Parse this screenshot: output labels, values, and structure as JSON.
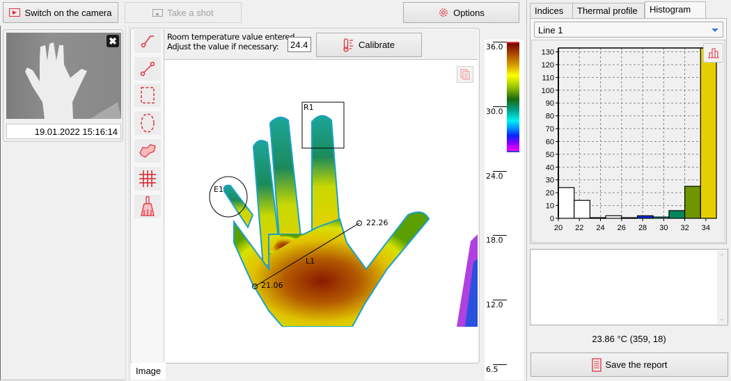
{
  "toolbar": {
    "camera_button": "Switch on the camera",
    "shot_button": "Take a shot",
    "options_button": "Options",
    "accent_color": "#e0303a"
  },
  "thumbnail": {
    "timestamp": "19.01.2022 15:16:14"
  },
  "calibration": {
    "message_line1": "Room temperature value entered.",
    "message_line2": "Adjust the value if necessary:",
    "room_temperature": "24.4",
    "calibrate_button": "Calibrate"
  },
  "tools": [
    {
      "name": "spot-line-tool-icon"
    },
    {
      "name": "line-tool-icon"
    },
    {
      "name": "rectangle-tool-icon"
    },
    {
      "name": "ellipse-tool-icon"
    },
    {
      "name": "polygon-tool-icon"
    },
    {
      "name": "grid-tool-icon"
    },
    {
      "name": "clear-tool-icon"
    }
  ],
  "image": {
    "tab_label": "Image",
    "annotations": {
      "rect_label": "R1",
      "ellipse_label": "E1",
      "line_label": "L1",
      "line_end_value": "22.26",
      "line_start_value": "21.06"
    }
  },
  "color_scale": {
    "labels": [
      "36.0",
      "30.0",
      "24.0",
      "18.0",
      "12.0",
      "6.5"
    ]
  },
  "right_panel": {
    "tabs": [
      {
        "label": "Indices",
        "active": false
      },
      {
        "label": "Thermal profile",
        "active": false
      },
      {
        "label": "Histogram",
        "active": true
      }
    ],
    "selector_value": "Line 1",
    "notes_text": "",
    "cursor_readout": "23.86 °C (359, 18)",
    "save_button": "Save the report"
  },
  "chart_data": {
    "type": "bar",
    "title": "",
    "xlabel": "",
    "ylabel": "",
    "x_ticks": [
      "20",
      "22",
      "24",
      "26",
      "28",
      "30",
      "32",
      "34"
    ],
    "y_ticks": [
      "0",
      "10",
      "20",
      "30",
      "40",
      "50",
      "60",
      "70",
      "80",
      "90",
      "100",
      "110",
      "120",
      "130"
    ],
    "xlim": [
      20,
      35
    ],
    "ylim": [
      0,
      133
    ],
    "grid": true,
    "bins": [
      {
        "from": 20.0,
        "to": 21.5,
        "value": 24,
        "color": "#ffffff"
      },
      {
        "from": 21.5,
        "to": 23.0,
        "value": 14,
        "color": "#ffffff"
      },
      {
        "from": 23.0,
        "to": 24.5,
        "value": 0.5,
        "color": "#ffffff"
      },
      {
        "from": 24.5,
        "to": 26.0,
        "value": 2,
        "color": "#ffffff"
      },
      {
        "from": 26.0,
        "to": 27.5,
        "value": 0.5,
        "color": "#ffffff"
      },
      {
        "from": 27.5,
        "to": 29.0,
        "value": 2,
        "color": "#0a2ee0"
      },
      {
        "from": 29.0,
        "to": 30.5,
        "value": 1,
        "color": "#19d8e8"
      },
      {
        "from": 30.5,
        "to": 32.0,
        "value": 6,
        "color": "#008858"
      },
      {
        "from": 32.0,
        "to": 33.5,
        "value": 25,
        "color": "#6f9600"
      },
      {
        "from": 33.5,
        "to": 35.0,
        "value": 133,
        "color": "#e6cf00"
      }
    ]
  }
}
